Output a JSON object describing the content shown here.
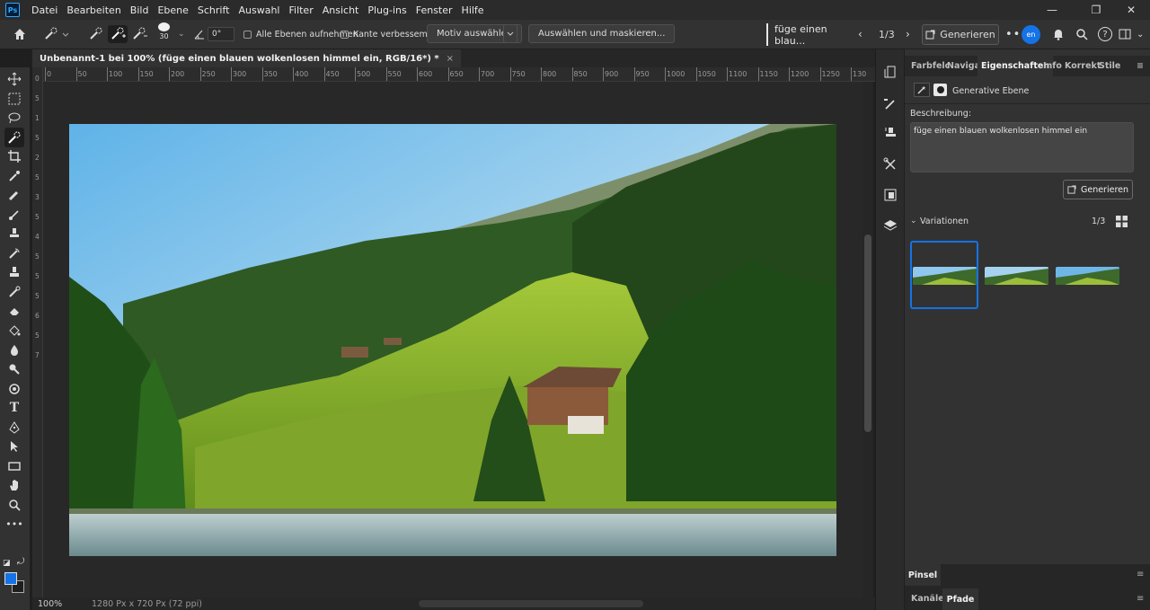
{
  "menu": {
    "app_icon": "Ps",
    "items": [
      "Datei",
      "Bearbeiten",
      "Bild",
      "Ebene",
      "Schrift",
      "Auswahl",
      "Filter",
      "Ansicht",
      "Plug-ins",
      "Fenster",
      "Hilfe"
    ]
  },
  "options": {
    "brush_size": "30",
    "angle": "0°",
    "sample_all_layers": "Alle Ebenen aufnehmen",
    "enhance_edge": "Kante verbessem",
    "select_subject": "Motiv auswählen",
    "select_and_mask": "Auswählen und maskieren...",
    "prompt_value": "füge einen blau...",
    "variation_counter": "1/3",
    "generate": "Generieren",
    "avatar_text": "en"
  },
  "document": {
    "tab_title": "Unbenannt-1 bei 100% (füge einen blauen wolkenlosen himmel ein, RGB/16*) *",
    "close": "×",
    "zoom": "100%",
    "dimensions": "1280 Px x 720 Px (72 ppi)"
  },
  "ruler": {
    "h_labels": [
      "0",
      "50",
      "100",
      "150",
      "200",
      "250",
      "300",
      "350",
      "400",
      "450",
      "500",
      "550",
      "600",
      "650",
      "700",
      "750",
      "800",
      "850",
      "900",
      "950",
      "1000",
      "1050",
      "1100",
      "1150",
      "1200",
      "1250",
      "130"
    ],
    "v_labels": [
      "0",
      "5",
      "1",
      "5",
      "2",
      "5",
      "3",
      "5",
      "4",
      "5",
      "5",
      "5",
      "6",
      "5",
      "7"
    ]
  },
  "panel": {
    "tabs": [
      "Farbfelc",
      "Navigat",
      "Eigenschaften",
      "Info",
      "Korrekt",
      "Stile"
    ],
    "active_tab": "Eigenschaften",
    "layer_type": "Generative Ebene",
    "description_label": "Beschreibung:",
    "description_text": "füge einen blauen wolkenlosen himmel ein",
    "generate": "Generieren",
    "variations_label": "Variationen",
    "variations_count": "1/3",
    "lower_tabs": [
      "Pinsel"
    ],
    "bottom_tabs": [
      "Kanäle",
      "Pfade"
    ]
  },
  "colors": {
    "accent": "#1473e6",
    "foreground_swatch": "#1473e6",
    "background_swatch": "#1f1f1f"
  }
}
